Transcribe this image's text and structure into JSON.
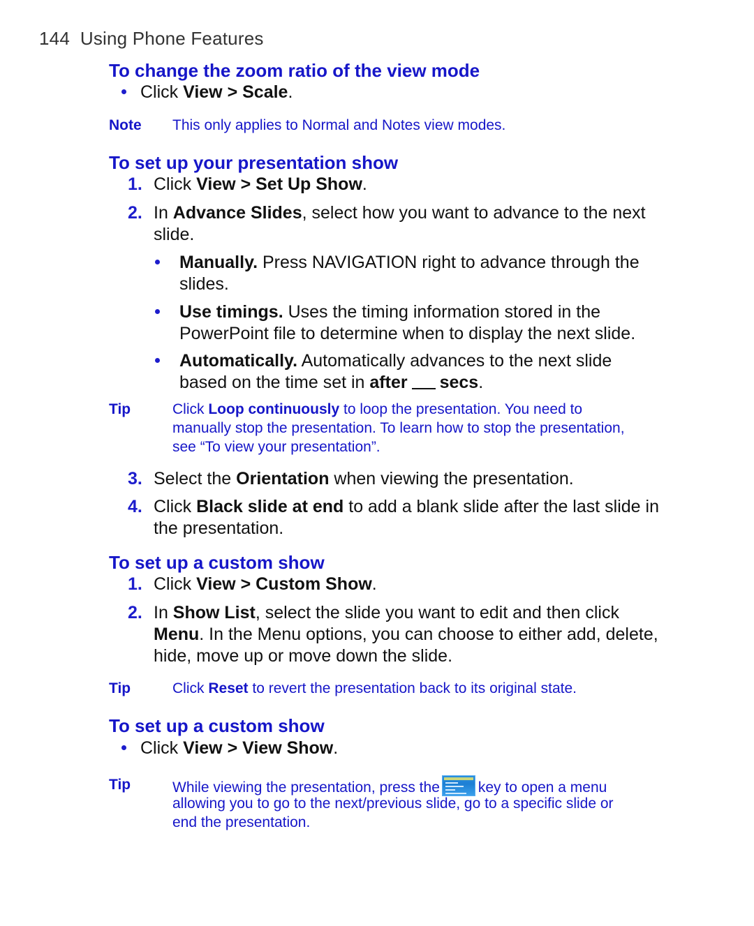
{
  "running_head": {
    "page_number": "144",
    "section": "Using Phone Features"
  },
  "sections": [
    {
      "heading": "To change the zoom ratio of the view mode",
      "items": [
        {
          "type": "bullet",
          "parts": [
            "Click ",
            "View > Scale",
            "."
          ]
        }
      ],
      "note": {
        "label": "Note",
        "text": "This only applies to Normal and Notes view modes."
      }
    },
    {
      "heading": "To set up your presentation show",
      "steps": [
        {
          "number": "1.",
          "parts": [
            "Click ",
            "View > Set Up Show",
            "."
          ]
        },
        {
          "number": "2.",
          "line1_parts": [
            "In ",
            "Advance Slides",
            ", select how you want to advance to the next"
          ],
          "line2": "slide."
        }
      ],
      "sub_bullets": [
        {
          "bold": "Manually.",
          "line1": " Press NAVIGATION right to advance through the",
          "line2": "slides."
        },
        {
          "bold": "Use timings.",
          "line1": " Uses the timing information stored in the",
          "line2": "PowerPoint file to determine when to display the next slide."
        },
        {
          "bold": "Automatically.",
          "line1": " Automatically advances to the next slide",
          "line2_parts": [
            "based on the time set in ",
            "after",
            "secs",
            "."
          ]
        }
      ],
      "tip": {
        "label": "Tip",
        "line1_parts": [
          "Click ",
          "Loop continuously",
          " to loop the presentation. You need to"
        ],
        "line2": "manually stop the presentation. To learn how to stop the presentation,",
        "line3": "see “To view your presentation”."
      },
      "steps_after": [
        {
          "number": "3.",
          "parts": [
            "Select the ",
            "Orientation",
            " when viewing the presentation."
          ]
        },
        {
          "number": "4.",
          "line1_parts": [
            "Click ",
            "Black slide at end",
            " to add a blank slide after the last slide in"
          ],
          "line2": "the presentation."
        }
      ]
    },
    {
      "heading": "To set up a custom show",
      "steps": [
        {
          "number": "1.",
          "parts": [
            "Click ",
            "View > Custom Show",
            "."
          ]
        },
        {
          "number": "2.",
          "line1_parts": [
            "In ",
            "Show List",
            ", select the slide you want to edit and then click"
          ],
          "line2_parts": [
            "Menu",
            ". In the Menu options, you can choose to either add, delete,"
          ],
          "line3": "hide, move up or move down the slide."
        }
      ],
      "tip": {
        "label": "Tip",
        "line1_parts": [
          "Click ",
          "Reset",
          " to revert the presentation back to its original state."
        ]
      }
    },
    {
      "heading": "To set up a custom show",
      "items": [
        {
          "type": "bullet",
          "parts": [
            "Click ",
            "View > View Show",
            "."
          ]
        }
      ],
      "tip": {
        "label": "Tip",
        "line1_before": "While viewing the presentation, press the",
        "key_icon": "start-menu-key-icon",
        "line1_after": "key to open a menu",
        "line2": "allowing you to go to the next/previous slide, go to a specific slide or",
        "line3": "end the presentation."
      }
    }
  ],
  "colors": {
    "heading": "#1616c8",
    "bullet": "#1d1dcc",
    "body": "#111111",
    "running_head": "#333333"
  }
}
